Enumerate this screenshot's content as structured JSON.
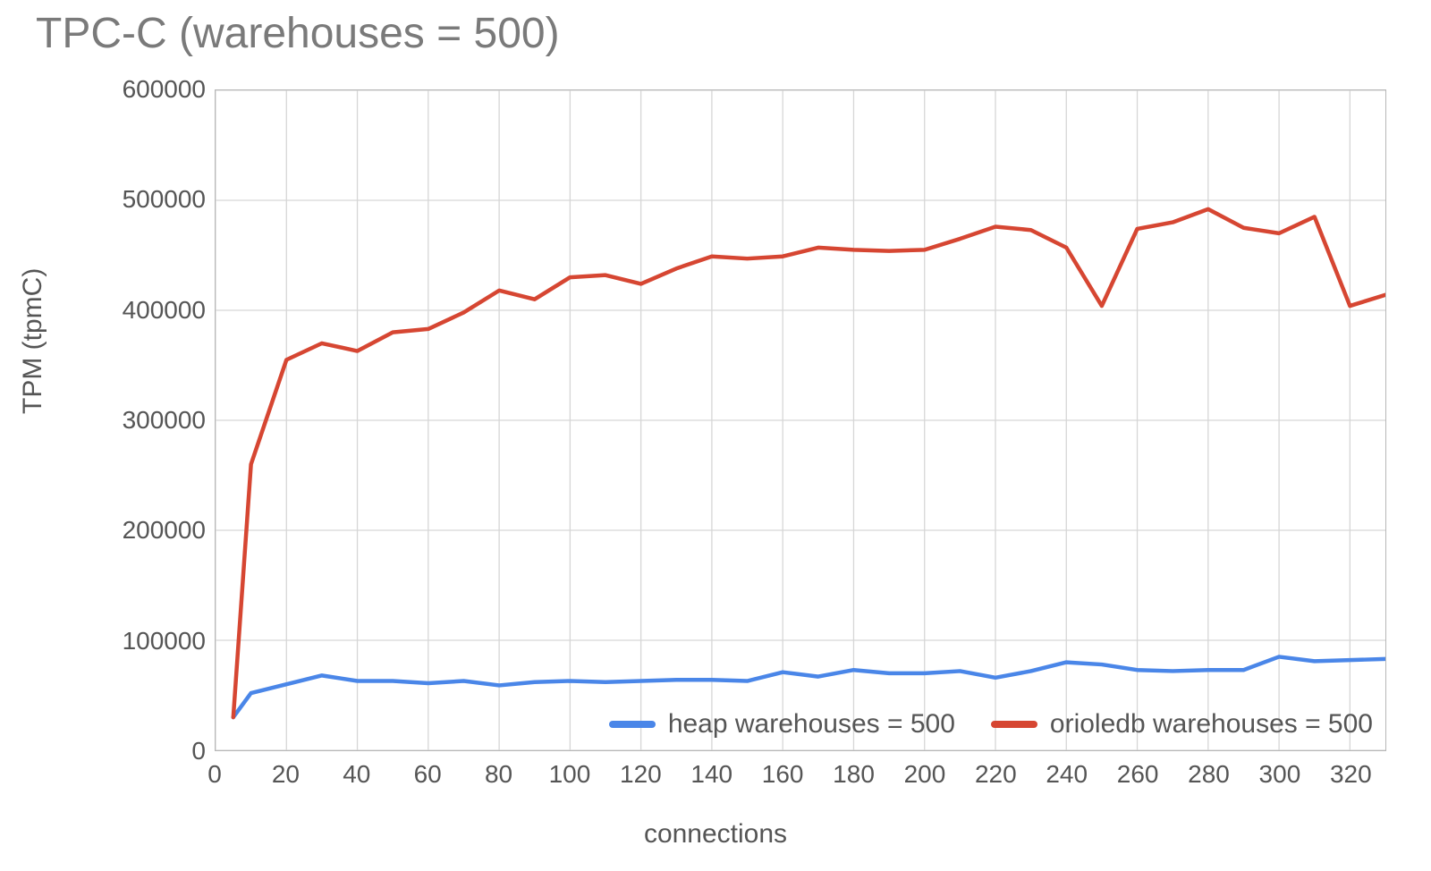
{
  "chart_data": {
    "type": "line",
    "title": "TPC-C (warehouses = 500)",
    "xlabel": "connections",
    "ylabel": "TPM (tpmC)",
    "xlim": [
      0,
      330
    ],
    "ylim": [
      0,
      600000
    ],
    "xticks": [
      0,
      20,
      40,
      60,
      80,
      100,
      120,
      140,
      160,
      180,
      200,
      220,
      240,
      260,
      280,
      300,
      320
    ],
    "yticks": [
      0,
      100000,
      200000,
      300000,
      400000,
      500000,
      600000
    ],
    "x": [
      5,
      10,
      20,
      30,
      40,
      50,
      60,
      70,
      80,
      90,
      100,
      110,
      120,
      130,
      140,
      150,
      160,
      170,
      180,
      190,
      200,
      210,
      220,
      230,
      240,
      250,
      260,
      270,
      280,
      290,
      300,
      310,
      320,
      330
    ],
    "series": [
      {
        "name": "heap warehouses = 500",
        "color": "#4a86e8",
        "values": [
          30000,
          52000,
          60000,
          68000,
          63000,
          63000,
          61000,
          63000,
          59000,
          62000,
          63000,
          62000,
          63000,
          64000,
          64000,
          63000,
          71000,
          67000,
          73000,
          70000,
          70000,
          72000,
          66000,
          72000,
          80000,
          78000,
          73000,
          72000,
          73000,
          73000,
          85000,
          81000,
          82000,
          83000
        ]
      },
      {
        "name": "orioledb warehouses = 500",
        "color": "#d64632",
        "values": [
          30000,
          260000,
          355000,
          370000,
          363000,
          380000,
          383000,
          398000,
          418000,
          410000,
          430000,
          432000,
          424000,
          438000,
          449000,
          447000,
          449000,
          457000,
          455000,
          454000,
          455000,
          465000,
          476000,
          473000,
          457000,
          404000,
          474000,
          480000,
          492000,
          475000,
          470000,
          485000,
          404000,
          414000
        ]
      }
    ],
    "legend_position": "bottom-right",
    "grid": true
  }
}
